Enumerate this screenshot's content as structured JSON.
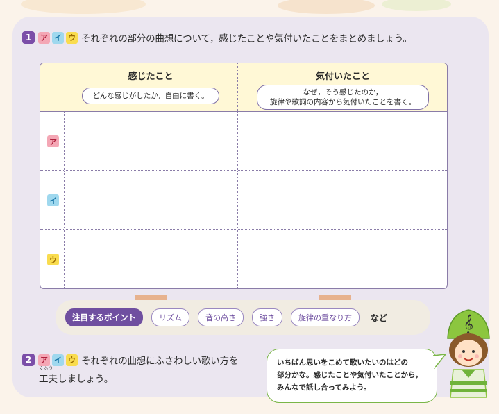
{
  "q1": {
    "number": "1",
    "keys": [
      "ア",
      "イ",
      "ウ"
    ],
    "text": "それぞれの部分の曲想について，感じたことや気付いたことをまとめましょう。"
  },
  "table": {
    "col1_title": "感じたこと",
    "col1_hint": "どんな感じがしたか，自由に書く。",
    "col2_title": "気付いたこと",
    "col2_hint_line1": "なぜ，そう感じたのか，",
    "col2_hint_line2": "旋律や歌詞の内容から気付いたことを書く。",
    "rows": [
      "ア",
      "イ",
      "ウ"
    ]
  },
  "points": {
    "label": "注目するポイント",
    "items": [
      "リズム",
      "音の高さ",
      "強さ",
      "旋律の重なり方"
    ],
    "suffix": "など"
  },
  "q2": {
    "number": "2",
    "keys": [
      "ア",
      "イ",
      "ウ"
    ],
    "text_line1": "それぞれの曲想にふさわしい歌い方を",
    "text_line2": "工夫しましょう。",
    "ruby": "くふう"
  },
  "bubble": {
    "line1": "いちばん思いをこめて歌いたいのはどの",
    "line2": "部分かな。感じたことや気付いたことから，",
    "line3": "みんなで話し合ってみよう。"
  },
  "colors": {
    "card_bg": "#ebe6f0",
    "accent_purple": "#6f4fa0",
    "header_yellow": "#fff8d6",
    "key_a": "#f4a7b5",
    "key_i": "#9fd8ee",
    "key_u": "#f9dc4f",
    "bubble_border": "#7ab648"
  }
}
